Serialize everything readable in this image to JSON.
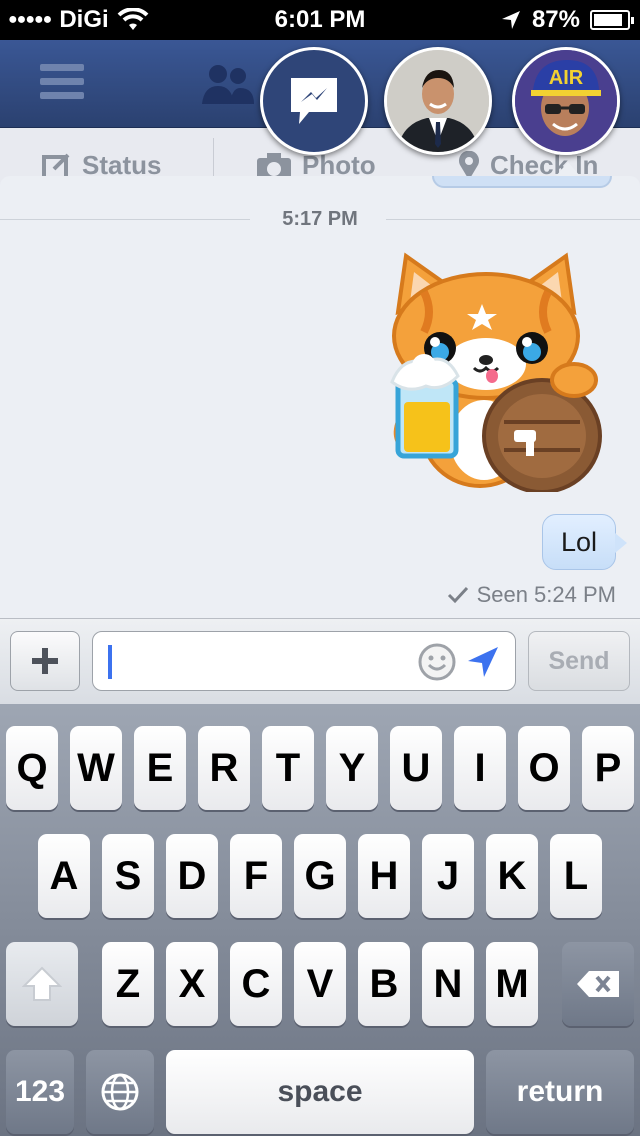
{
  "status_bar": {
    "carrier": "DiGi",
    "time": "6:01 PM",
    "battery": "87%",
    "battery_level": 0.87
  },
  "fb_nav": {
    "status_label": "Status",
    "photo_label": "Photo",
    "checkin_label": "Check In"
  },
  "chat_heads": [
    "messenger-head",
    "contact-head",
    "contact-head-air-cap"
  ],
  "conversation": {
    "timestamp": "5:17 PM",
    "sticker": "cat-with-beer-and-barrel-sticker",
    "message": "Lol",
    "seen": "Seen 5:24 PM"
  },
  "composer": {
    "input_value": "",
    "send_label": "Send"
  },
  "keyboard": {
    "row1": [
      "Q",
      "W",
      "E",
      "R",
      "T",
      "Y",
      "U",
      "I",
      "O",
      "P"
    ],
    "row2": [
      "A",
      "S",
      "D",
      "F",
      "G",
      "H",
      "J",
      "K",
      "L"
    ],
    "row3": [
      "Z",
      "X",
      "C",
      "V",
      "B",
      "N",
      "M"
    ],
    "numbers_label": "123",
    "space_label": "space",
    "return_label": "return"
  },
  "colors": {
    "fb_blue": "#3a5795",
    "bubble_blue": "#cfe3fa",
    "caret_blue": "#3c72ef"
  }
}
